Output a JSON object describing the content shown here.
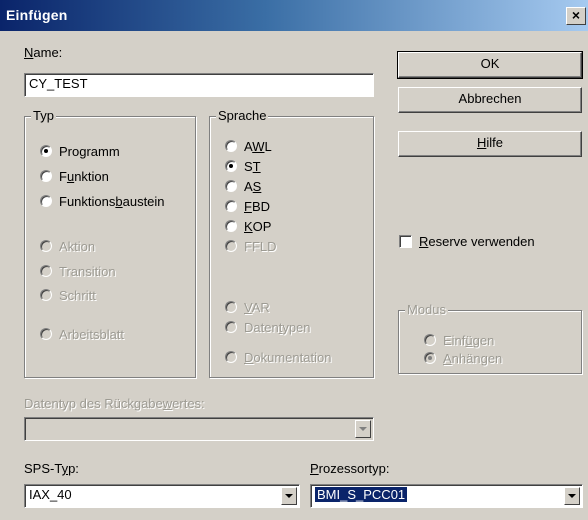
{
  "window": {
    "title": "Einfügen",
    "close_glyph": "×"
  },
  "name": {
    "label": "Name:",
    "value": "CY_TEST"
  },
  "buttons": {
    "ok": "OK",
    "cancel": "Abbrechen",
    "help": "Hilfe"
  },
  "typ": {
    "title": "Typ",
    "options": [
      "Programm",
      "Funktion",
      "Funktionsbaustein"
    ],
    "disabled_options": [
      "Aktion",
      "Transition",
      "Schritt"
    ],
    "worksheet": "Arbeitsblatt",
    "selected": "Programm"
  },
  "sprache": {
    "title": "Sprache",
    "options": [
      "AWL",
      "ST",
      "AS",
      "FBD",
      "KOP"
    ],
    "disabled_options": [
      "FFLD"
    ],
    "lower_disabled": [
      "VAR",
      "Datentypen",
      "Dokumentation"
    ],
    "selected": "ST"
  },
  "reserve": {
    "label": "Reserve verwenden",
    "checked": false
  },
  "modus": {
    "title": "Modus",
    "options": [
      "Einfügen",
      "Anhängen"
    ],
    "selected": "Anhängen"
  },
  "return_type": {
    "label": "Datentyp des Rückgabewertes:",
    "value": ""
  },
  "sps": {
    "label": "SPS-Typ:",
    "value": "IAX_40"
  },
  "processor": {
    "label": "Prozessortyp:",
    "value": "BMI_S_PCC01"
  },
  "icons": [
    "close-icon",
    "radio-button",
    "checkbox",
    "dropdown-arrow-icon"
  ]
}
